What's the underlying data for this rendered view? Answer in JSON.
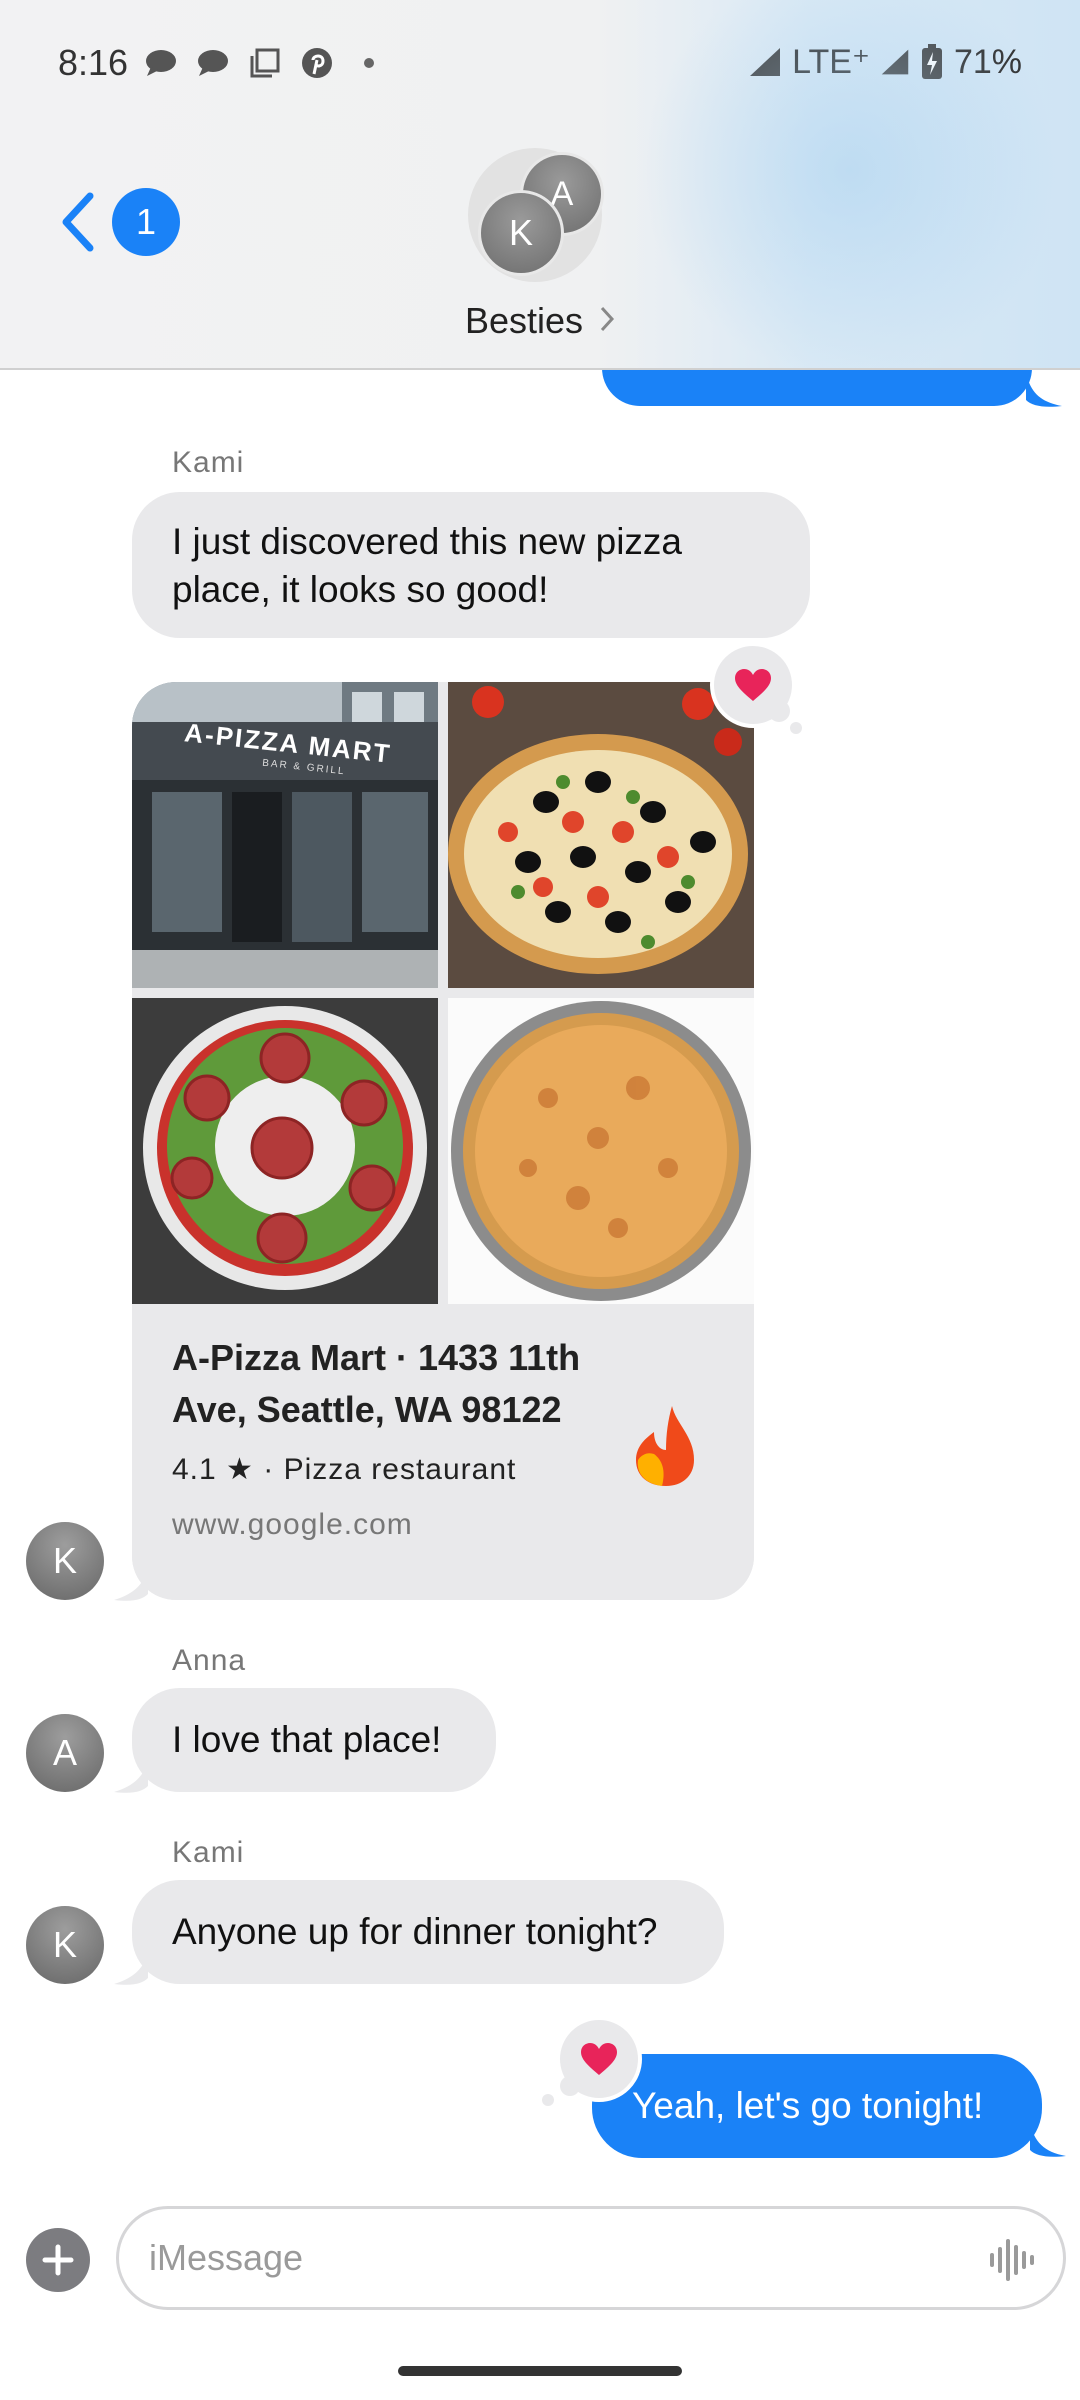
{
  "status_bar": {
    "time": "8:16",
    "network": "LTE⁺",
    "battery": "71%",
    "icons": [
      "message-icon",
      "message-icon",
      "screenshot-icon",
      "pinterest-icon",
      "dot-icon",
      "signal-icon",
      "battery-icon"
    ]
  },
  "header": {
    "unread_count": "1",
    "avatar_a": "A",
    "avatar_k": "K",
    "group_name": "Besties",
    "group_chevron": ">"
  },
  "messages": [
    {
      "id": "m1",
      "sender": "Kami",
      "type": "text",
      "text": "I just discovered this new pizza place, it looks so good!"
    },
    {
      "id": "m2",
      "sender": "Kami",
      "type": "link_card",
      "title": "A-Pizza Mart · 1433 11th Ave, Seattle, WA 98122",
      "rating": "4.1 ★ · Pizza restaurant",
      "domain": "www.google.com",
      "reaction": "heart-icon",
      "photos": [
        "storefront-photo",
        "olive-pizza-photo",
        "salad-photo",
        "cheese-pizza-photo"
      ],
      "storefront_sign": "A-PIZZA MART",
      "storefront_subsign": "BAR & GRILL"
    },
    {
      "id": "m3",
      "sender": "Anna",
      "type": "text",
      "text": "I love that place!"
    },
    {
      "id": "m4",
      "sender": "Kami",
      "type": "text",
      "text": "Anyone up for dinner tonight?"
    },
    {
      "id": "m5",
      "sender": "me",
      "type": "text",
      "text": "Yeah, let's go tonight!",
      "reaction": "heart-icon"
    }
  ],
  "avatars": {
    "kami": "K",
    "anna": "A"
  },
  "input": {
    "placeholder": "iMessage"
  },
  "colors": {
    "accent": "#1a82f7",
    "bubble_gray": "#e9e9eb",
    "heart": "#e8245a"
  }
}
